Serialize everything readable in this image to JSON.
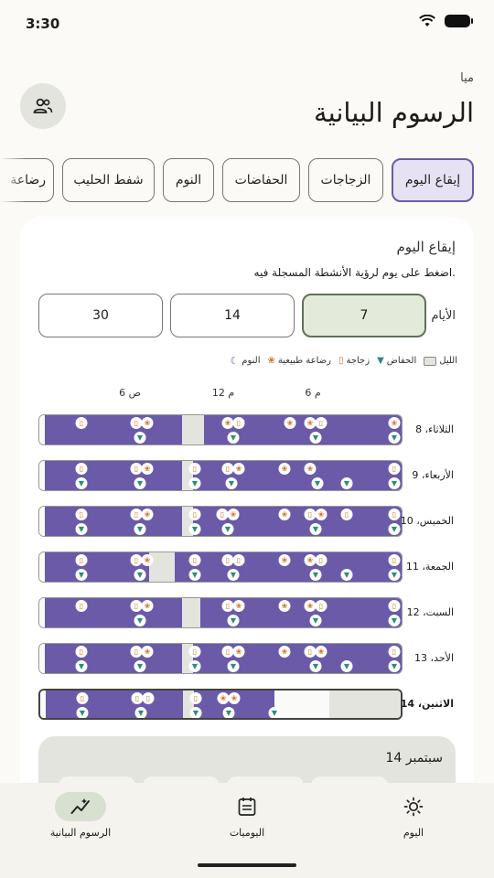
{
  "status": {
    "time": "3:30"
  },
  "header": {
    "subtitle": "ميا",
    "title": "الرسوم البيانية"
  },
  "tabs": [
    {
      "label": "إيقاع اليوم",
      "active": true
    },
    {
      "label": "الزجاجات",
      "active": false
    },
    {
      "label": "الحفاضات",
      "active": false
    },
    {
      "label": "النوم",
      "active": false
    },
    {
      "label": "شفط الحليب",
      "active": false
    },
    {
      "label": "رضاعة",
      "active": false
    }
  ],
  "card": {
    "title": "إيقاع اليوم",
    "hint": "اضغط على يوم لرؤية الأنشطة المسجلة فيه.",
    "range_label": "الأيام",
    "ranges": [
      {
        "label": "7",
        "active": true
      },
      {
        "label": "14",
        "active": false
      },
      {
        "label": "30",
        "active": false
      }
    ],
    "legend": [
      {
        "label": "النوم",
        "icon": "moon-icon"
      },
      {
        "label": "رضاعة طبيعية",
        "icon": "breastfeed-icon"
      },
      {
        "label": "زجاجة",
        "icon": "bottle-icon"
      },
      {
        "label": "الحفاض",
        "icon": "diaper-icon"
      },
      {
        "label": "الليل",
        "icon": "night-swatch"
      }
    ],
    "ticks": [
      "6 م",
      "12 م",
      "6 ص"
    ],
    "days": [
      {
        "label": "الثلاثاء، 8"
      },
      {
        "label": "الأربعاء، 9"
      },
      {
        "label": "الخميس، 10"
      },
      {
        "label": "الجمعة، 11"
      },
      {
        "label": "السبت، 12"
      },
      {
        "label": "الأحد، 13"
      },
      {
        "label": "الاثنين، 14",
        "selected": true
      }
    ],
    "detail_title": "14 سبتمبر"
  },
  "nav": [
    {
      "label": "اليوم",
      "icon": "sun-icon",
      "active": false
    },
    {
      "label": "اليوميات",
      "icon": "calendar-icon",
      "active": false
    },
    {
      "label": "الرسوم البيانية",
      "icon": "chart-icon",
      "active": true
    }
  ],
  "colors": {
    "sleep": "#6b5aa8",
    "night": "#e3e4de",
    "accent": "#6f5aa6",
    "bottle": "#d0732c",
    "diaper": "#2b8c7e"
  }
}
